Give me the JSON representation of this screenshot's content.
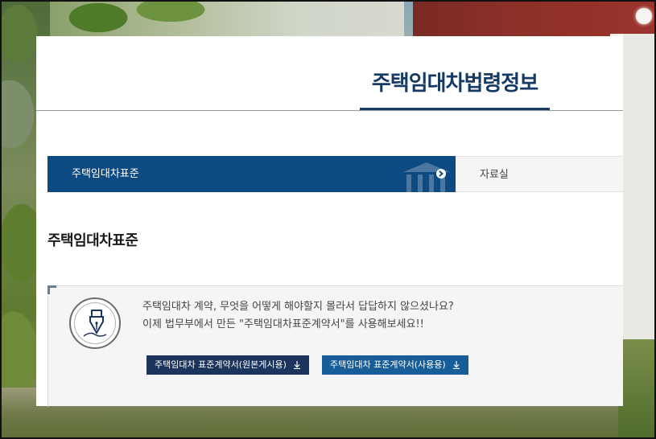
{
  "header": {
    "site_title": "주택임대차법령정보"
  },
  "tabs": [
    {
      "label": "주택임대차표준",
      "active": true
    },
    {
      "label": "자료실",
      "active": false
    }
  ],
  "section": {
    "heading": "주택임대차표준"
  },
  "info": {
    "line1": "주택임대차 계약, 무엇을 어떻게 해야할지 몰라서 답답하지 않으셨나요?",
    "line2": "이제 법무부에서 만든 \"주택임대차표준계약서\"를 사용해보세요!!",
    "buttons": {
      "original_label": "주택임대차 표준계약서(원본게시용)",
      "use_label": "주택임대차 표준계약서(사용용)"
    }
  },
  "icons": {
    "pen": "fountain-pen-icon",
    "building": "building-icon",
    "arrow": "arrow-right-circle-icon",
    "download": "download-icon"
  },
  "colors": {
    "primary": "#153a64",
    "active_tab": "#0e4a82",
    "btn_original": "#1b355f",
    "btn_use": "#175e98"
  }
}
